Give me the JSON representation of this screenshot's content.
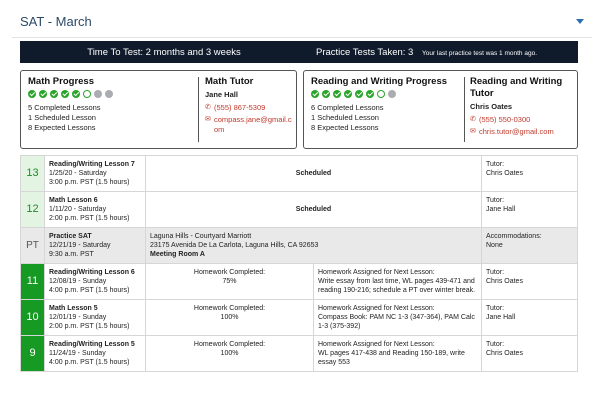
{
  "header": {
    "title": "SAT - March"
  },
  "timebar": {
    "time_to_test": "Time To Test: 2 months and 3 weeks",
    "practice_tests": "Practice Tests Taken: 3",
    "last_practice": "Your last practice test was 1 month ago."
  },
  "math": {
    "progress_title": "Math Progress",
    "dots": [
      "done",
      "done",
      "done",
      "done",
      "done",
      "scheduled",
      "expected",
      "expected"
    ],
    "completed": "5 Completed Lessons",
    "scheduled": "1 Scheduled Lesson",
    "expected": "8 Expected Lessons",
    "tutor_title": "Math Tutor",
    "tutor_name": "Jane Hall",
    "phone": "(555) 867-5309",
    "email": "compass.jane@gmail.com"
  },
  "rw": {
    "progress_title": "Reading and Writing Progress",
    "dots": [
      "done",
      "done",
      "done",
      "done",
      "done",
      "done",
      "scheduled",
      "expected"
    ],
    "completed": "6 Completed Lessons",
    "scheduled": "1 Scheduled Lesson",
    "expected": "8 Expected Lessons",
    "tutor_title": "Reading and Writing Tutor",
    "tutor_name": "Chris Oates",
    "phone": "(555) 550-0300",
    "email": "chris.tutor@gmail.com"
  },
  "lessons": [
    {
      "num": "13",
      "name": "Reading/Writing Lesson 7",
      "date": "1/25/20 - Saturday",
      "time": "3:00 p.m. PST (1.5 hours)",
      "status": "Scheduled",
      "tutor_label": "Tutor:",
      "tutor": "Chris Oates"
    },
    {
      "num": "12",
      "name": "Math Lesson 6",
      "date": "1/11/20 - Saturday",
      "time": "2:00 p.m. PST (1.5 hours)",
      "status": "Scheduled",
      "tutor_label": "Tutor:",
      "tutor": "Jane Hall"
    },
    {
      "num": "PT",
      "name": "Practice SAT",
      "date": "12/21/19 - Saturday",
      "time": "9:30 a.m. PST",
      "location": "Laguna Hills - Courtyard Marriott",
      "address": "23175 Avenida De La Carlota, Laguna Hills, CA 92653",
      "room": "Meeting Room A",
      "acc_label": "Accommodations:",
      "acc": "None"
    },
    {
      "num": "11",
      "name": "Reading/Writing Lesson 6",
      "date": "12/08/19 - Sunday",
      "time": "4:00 p.m. PST (1.5 hours)",
      "hw_label": "Homework Completed:",
      "hw": "75%",
      "next_label": "Homework Assigned for Next Lesson:",
      "next": "Write essay from last time, WL pages 439-471 and reading 190-216; schedule a PT over winter break.",
      "tutor_label": "Tutor:",
      "tutor": "Chris Oates"
    },
    {
      "num": "10",
      "name": "Math Lesson 5",
      "date": "12/01/19 - Sunday",
      "time": "2:00 p.m. PST (1.5 hours)",
      "hw_label": "Homework Completed:",
      "hw": "100%",
      "next_label": "Homework Assigned for Next Lesson:",
      "next": "Compass Book: PAM NC 1-3 (347-364), PAM Calc 1-3 (375-392)",
      "tutor_label": "Tutor:",
      "tutor": "Jane Hall"
    },
    {
      "num": "9",
      "name": "Reading/Writing Lesson 5",
      "date": "11/24/19 - Sunday",
      "time": "4:00 p.m. PST (1.5 hours)",
      "hw_label": "Homework Completed:",
      "hw": "100%",
      "next_label": "Homework Assigned for Next Lesson:",
      "next": "WL pages 417-438 and Reading 150-189, write essay 553",
      "tutor_label": "Tutor:",
      "tutor": "Chris Oates"
    }
  ]
}
